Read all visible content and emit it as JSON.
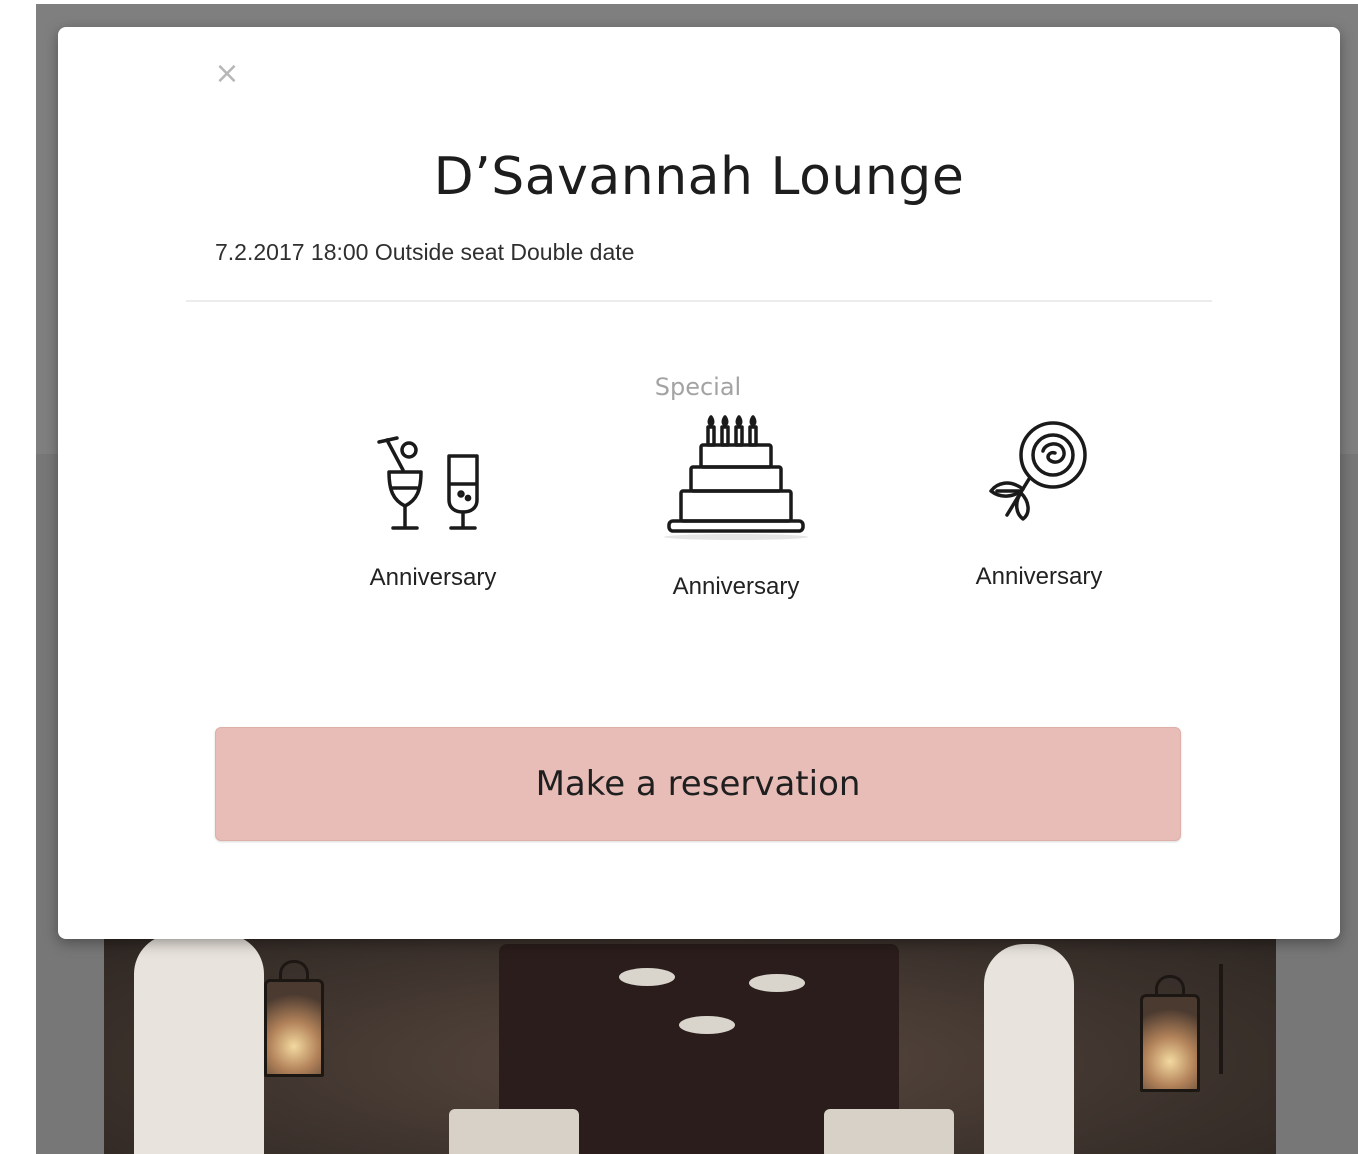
{
  "modal": {
    "close_glyph": "×",
    "title": "D’Savannah Lounge",
    "details": "7.2.2017 18:00 Outside seat Double date",
    "special_label": "Special",
    "options": [
      {
        "icon": "drinks-icon",
        "label": "Anniversary"
      },
      {
        "icon": "cake-icon",
        "label": "Anniversary"
      },
      {
        "icon": "rose-icon",
        "label": "Anniversary"
      }
    ],
    "reserve_label": "Make a reservation"
  },
  "colors": {
    "accent_button": "#e8bdb7",
    "overlay": "#7d7d7d",
    "special_text": "#a3a3a3"
  }
}
